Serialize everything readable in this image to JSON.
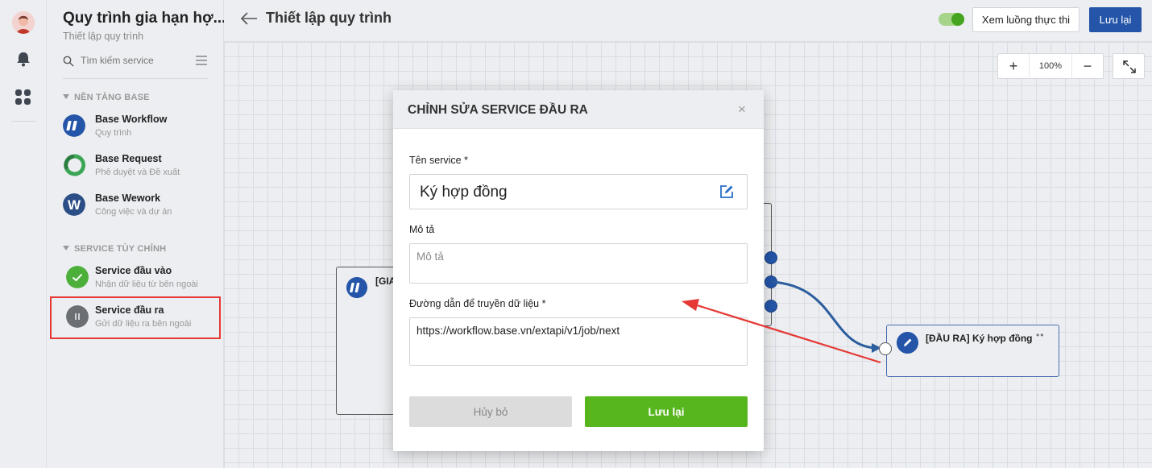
{
  "sidebar": {
    "title": "Quy trình gia hạn hợ...",
    "subtitle": "Thiết lập quy trình",
    "search_placeholder": "Tìm kiếm service",
    "sections": [
      {
        "label": "NỀN TẢNG BASE"
      },
      {
        "label": "SERVICE TÙY CHỈNH"
      }
    ],
    "items": [
      {
        "name": "Base Workflow",
        "desc": "Quy trình",
        "icon": "base-workflow-icon"
      },
      {
        "name": "Base Request",
        "desc": "Phê duyệt và Đề xuất",
        "icon": "base-request-icon"
      },
      {
        "name": "Base Wework",
        "desc": "Công việc và dự án",
        "icon": "base-wework-icon"
      },
      {
        "name": "Service đầu vào",
        "desc": "Nhận dữ liệu từ bên ngoài",
        "icon": "check-icon"
      },
      {
        "name": "Service đầu ra",
        "desc": "Gửi dữ liệu ra bên ngoài",
        "icon": "pause-icon"
      }
    ]
  },
  "header": {
    "title": "Thiết lập quy trình",
    "flow_button": "Xem luồng thực thi",
    "save_button": "Lưu lại"
  },
  "canvas": {
    "zoom_in": "+",
    "zoom_level": "100%",
    "zoom_out": "−",
    "left_node_label": "[GIA",
    "right_node_label": "[ĐẦU RA] Ký hợp đồng",
    "right_node_menu": "••"
  },
  "modal": {
    "title": "CHỈNH SỬA SERVICE ĐẦU RA",
    "close": "×",
    "name_label": "Tên service *",
    "name_value": "Ký hợp đồng",
    "desc_label": "Mô tả",
    "desc_placeholder": "Mô tả",
    "url_label": "Đường dẫn để truyền dữ liệu *",
    "url_value": "https://workflow.base.vn/extapi/v1/job/next",
    "cancel_button": "Hủy bỏ",
    "save_button": "Lưu lại"
  },
  "colors": {
    "primary": "#2455a8",
    "success": "#57b51d",
    "highlight": "#e53935"
  }
}
